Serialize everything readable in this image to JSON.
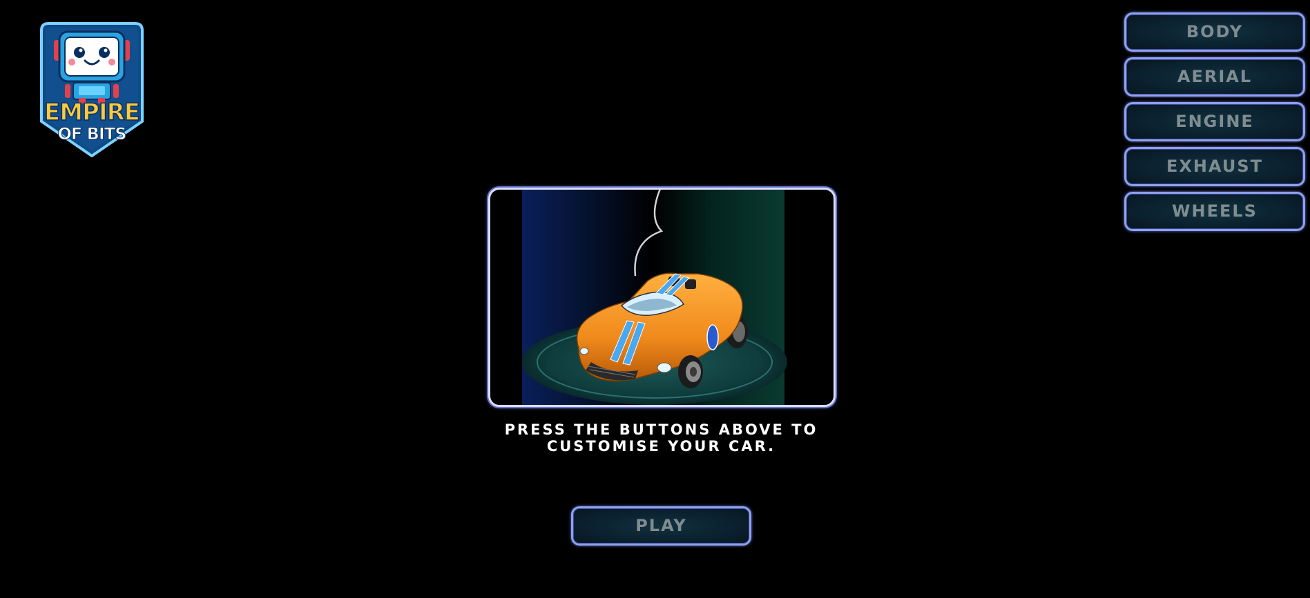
{
  "logo": {
    "line1": "EMPIRE",
    "line2": "OF BITS",
    "icon": "robot-mascot-icon"
  },
  "menu": {
    "items": [
      {
        "label": "BODY"
      },
      {
        "label": "AERIAL"
      },
      {
        "label": "ENGINE"
      },
      {
        "label": "EXHAUST"
      },
      {
        "label": "WHEELS"
      }
    ]
  },
  "preview": {
    "subject": "orange-rc-car"
  },
  "instruction": {
    "text": "PRESS THE BUTTONS ABOVE TO CUSTOMISE YOUR CAR."
  },
  "play": {
    "label": "PLAY"
  },
  "colors": {
    "background": "#000000",
    "button_border": "#8ea0ee",
    "button_fill": "#0b2230",
    "button_text": "#7f8c90",
    "car_body": "#f08a1c",
    "car_stripe": "#4aa8f0",
    "logo_gold": "#ffc93c",
    "logo_blue": "#0a2f5e"
  }
}
